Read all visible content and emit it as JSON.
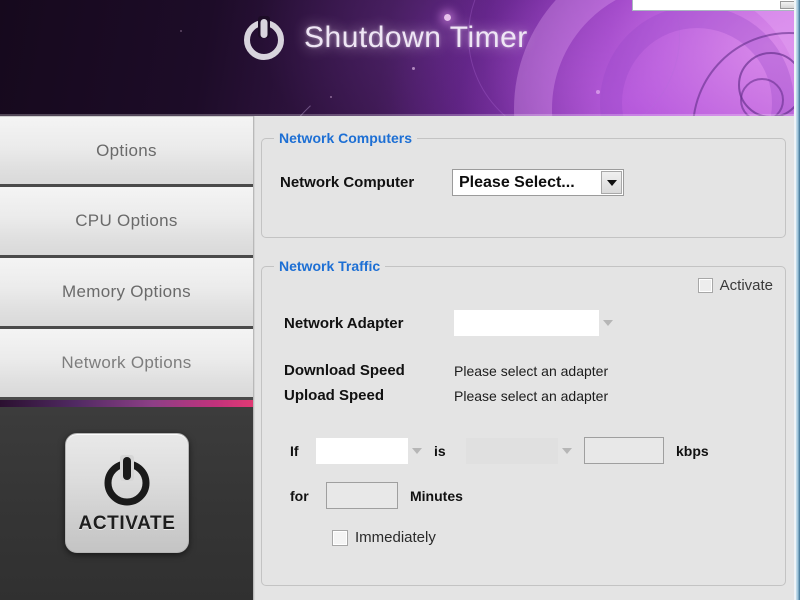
{
  "window": {
    "title": "Shutdown Timer",
    "brand_icon": "power-icon"
  },
  "sidebar": {
    "items": [
      {
        "label": "Options",
        "name": "options"
      },
      {
        "label": "CPU Options",
        "name": "cpu-options"
      },
      {
        "label": "Memory Options",
        "name": "memory-options"
      },
      {
        "label": "Network Options",
        "name": "network-options"
      }
    ],
    "activate": {
      "label": "ACTIVATE",
      "icon": "power-icon"
    }
  },
  "content": {
    "network_computers": {
      "title": "Network Computers",
      "computer_label": "Network Computer",
      "computer_value": "Please Select...",
      "dropdown_icon": "caret-down-icon"
    },
    "network_traffic": {
      "title": "Network Traffic",
      "activate_checkbox_label": "Activate",
      "activate_checked": false,
      "adapter_label": "Network Adapter",
      "adapter_value": "",
      "adapter_dropdown_icon": "caret-down-icon",
      "download_label": "Download Speed",
      "download_value": "Please select an adapter",
      "upload_label": "Upload Speed",
      "upload_value": "Please select an adapter",
      "condition": {
        "if_label": "If",
        "metric_value": "",
        "is_label": "is",
        "operator_value": "",
        "threshold_value": "",
        "unit_label": "kbps",
        "for_label": "for",
        "duration_value": "",
        "minutes_label": "Minutes",
        "immediately_label": "Immediately",
        "immediately_checked": false
      }
    }
  },
  "colors": {
    "accent_blue": "#1d6fd4",
    "header_purple": "#6b2494",
    "divider_pink": "#e03a73",
    "panel_dark": "#353535"
  }
}
